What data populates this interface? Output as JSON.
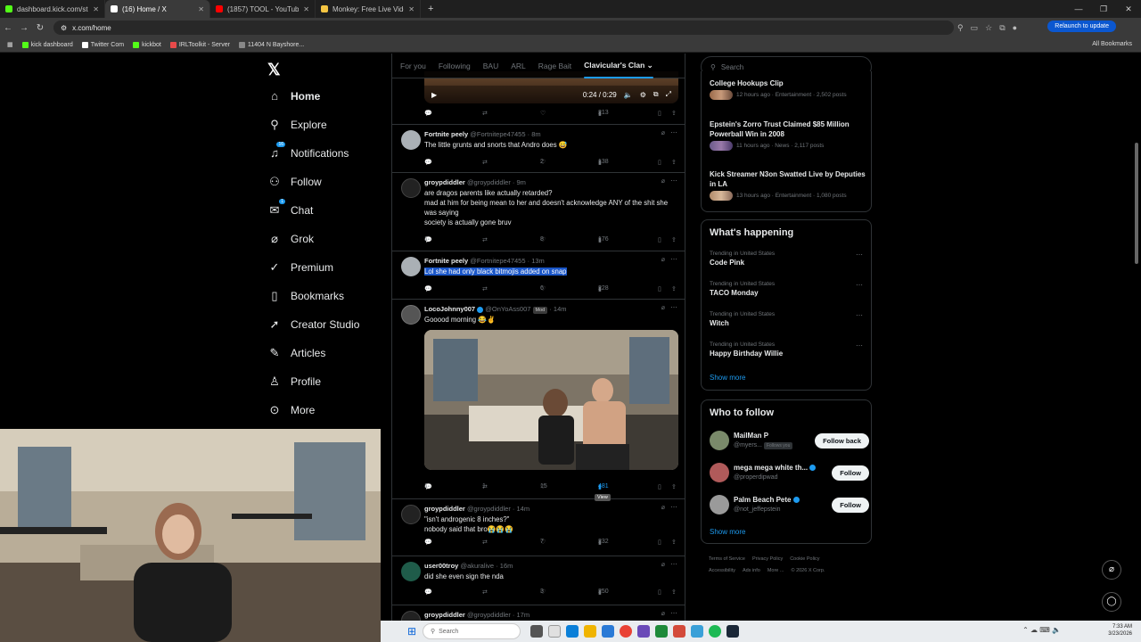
{
  "browser": {
    "tabs": [
      {
        "title": "dashboard.kick.com/stream",
        "color": "#53fc18"
      },
      {
        "title": "(16) Home / X",
        "color": "#ffffff"
      },
      {
        "title": "(1857) TOOL - YouTube",
        "color": "#ff0000"
      },
      {
        "title": "Monkey: Free Live Video C",
        "color": "#f5c542"
      }
    ],
    "url": "x.com/home",
    "relaunch_label": "Relaunch to update",
    "bookmarks": [
      {
        "label": "kick dashboard",
        "color": "#53fc18"
      },
      {
        "label": "Twitter Com",
        "color": "#ffffff"
      },
      {
        "label": "kickbot",
        "color": "#53fc18"
      },
      {
        "label": "IRLToolkit - Server",
        "color": "#e84a4a"
      },
      {
        "label": "11404 N Bayshore...",
        "color": "#888888"
      }
    ],
    "all_bookmarks": "All Bookmarks"
  },
  "sidebar": {
    "items": [
      {
        "label": "Home",
        "icon": "home-icon",
        "glyph": "⌂"
      },
      {
        "label": "Explore",
        "icon": "search-icon",
        "glyph": "⚲"
      },
      {
        "label": "Notifications",
        "icon": "bell-icon",
        "glyph": "🔔",
        "badge": "16"
      },
      {
        "label": "Follow",
        "icon": "person-plus-icon",
        "glyph": "👤"
      },
      {
        "label": "Chat",
        "icon": "mail-icon",
        "glyph": "✉",
        "badge": "1"
      },
      {
        "label": "Grok",
        "icon": "grok-icon",
        "glyph": "⌀"
      },
      {
        "label": "Premium",
        "icon": "check-badge-icon",
        "glyph": "✓"
      },
      {
        "label": "Bookmarks",
        "icon": "bookmark-icon",
        "glyph": "❏"
      },
      {
        "label": "Creator Studio",
        "icon": "rocket-icon",
        "glyph": "➚"
      },
      {
        "label": "Articles",
        "icon": "article-icon",
        "glyph": "✎"
      },
      {
        "label": "Profile",
        "icon": "profile-icon",
        "glyph": "👤"
      },
      {
        "label": "More",
        "icon": "more-circle-icon",
        "glyph": "⋯"
      }
    ]
  },
  "feed": {
    "tabs": [
      "For you",
      "Following",
      "BAU",
      "ARL",
      "Rage Bait",
      "Clavicular's Clan"
    ],
    "video": {
      "time": "0:24 / 0:29"
    },
    "top_actions": {
      "views": "213"
    },
    "posts": [
      {
        "name": "Fortnite peely",
        "handle": "@Fortnitepe47455",
        "time": "· 8m",
        "text": [
          "The little grunts and snorts that Andro does 😅"
        ],
        "replies": "",
        "likes": "2",
        "views": "138"
      },
      {
        "name": "groypdiddler",
        "handle": "@groypdiddler",
        "time": "· 9m",
        "text": [
          "are dragos parents like actually retarded?",
          "mad at him for being mean to her and doesn't acknowledge ANY of the shit she was saying",
          "society is actually gone bruv"
        ],
        "replies": "1",
        "likes": "8",
        "views": "176"
      },
      {
        "name": "Fortnite peely",
        "handle": "@Fortnitepe47455",
        "time": "· 13m",
        "text": [
          "Lol she had only black bitmojis added on snap"
        ],
        "replies": "",
        "likes": "6",
        "views": "228"
      },
      {
        "name": "LocoJohnny007",
        "handle": "@OnYoAss007",
        "badge": "Mod",
        "time": "· 14m",
        "text": [
          "Gooood morning 😂✌️"
        ],
        "replies": "1",
        "reposts": "1",
        "likes": "15",
        "views": "481",
        "tooltip": "View"
      },
      {
        "name": "groypdiddler",
        "handle": "@groypdiddler",
        "time": "· 14m",
        "text": [
          "\"isn't androgenic 8 inches?\"",
          "nobody said that bro😭😭😭"
        ],
        "replies": "",
        "likes": "7",
        "views": "232"
      },
      {
        "name": "user00troy",
        "handle": "@akuralive",
        "time": "· 16m",
        "text": [
          "did she even sign the nda"
        ],
        "replies": "",
        "likes": "3",
        "views": "250"
      },
      {
        "name": "groypdiddler",
        "handle": "@groypdiddler",
        "time": "· 17m",
        "text": [],
        "replies": "",
        "likes": "",
        "views": ""
      }
    ]
  },
  "right": {
    "search_placeholder": "Search",
    "news": [
      {
        "title": "College Hookups Clip",
        "meta": "12 hours ago · Entertainment · 2,502 posts"
      },
      {
        "title": "Epstein's Zorro Trust Claimed $85 Million Powerball Win in 2008",
        "meta": "11 hours ago · News · 2,117 posts"
      },
      {
        "title": "Kick Streamer N3on Swatted Live by Deputies in LA",
        "meta": "13 hours ago · Entertainment · 1,080 posts"
      }
    ],
    "happening_title": "What's happening",
    "trends": [
      {
        "context": "Trending in United States",
        "name": "Code Pink"
      },
      {
        "context": "Trending in United States",
        "name": "TACO Monday"
      },
      {
        "context": "Trending in United States",
        "name": "Witch"
      },
      {
        "context": "Trending in United States",
        "name": "Happy Birthday Willie"
      }
    ],
    "show_more": "Show more",
    "who_title": "Who to follow",
    "who": [
      {
        "name": "MailMan P",
        "handle": "@myers...",
        "follows_you": "Follows you",
        "button": "Follow back"
      },
      {
        "name": "mega mega white th...",
        "handle": "@properdipwad",
        "button": "Follow"
      },
      {
        "name": "Palm Beach Pete",
        "handle": "@not_jeffepstein",
        "button": "Follow"
      }
    ],
    "footer": [
      "Terms of Service",
      "Privacy Policy",
      "Cookie Policy",
      "Accessibility",
      "Ads info",
      "More ...",
      "© 2026 X Corp."
    ]
  },
  "taskbar": {
    "search": "Search",
    "time": "7:33 AM",
    "date": "3/23/2026"
  }
}
